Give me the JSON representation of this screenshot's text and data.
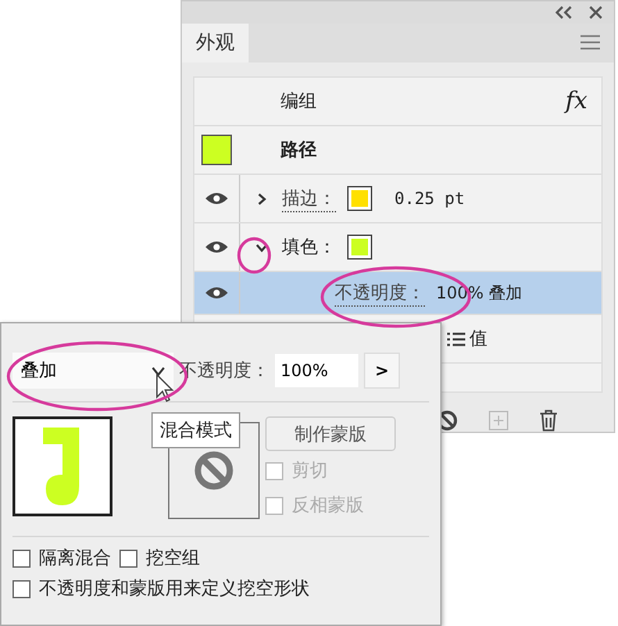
{
  "appearance_panel": {
    "tab": {
      "label": "外观",
      "selected": true
    },
    "rows": [
      {
        "kind": "group",
        "label": "编组",
        "fx": "fx"
      },
      {
        "kind": "path",
        "label": "路径",
        "color": "#ccff22"
      },
      {
        "kind": "stroke",
        "label": "描边：",
        "color": "#ffe000",
        "value": "0.25 pt",
        "expanded": false,
        "visible": true
      },
      {
        "kind": "fill",
        "label": "填色：",
        "color": "#ccff22",
        "expanded": true,
        "visible": true
      },
      {
        "kind": "opacity",
        "label": "不透明度：",
        "value": "100% 叠加",
        "selected": true,
        "visible": true
      },
      {
        "kind": "default",
        "label": "值"
      }
    ]
  },
  "transparency_popup": {
    "blend_mode": "叠加",
    "opacity_label": "不透明度：",
    "opacity_value": "100%",
    "opacity_button": ">",
    "tooltip": "混合模式",
    "make_mask_button": "制作蒙版",
    "mask_options": [
      {
        "label": "剪切",
        "checked": false,
        "disabled": true
      },
      {
        "label": "反相蒙版",
        "checked": false,
        "disabled": true
      }
    ],
    "options": [
      {
        "label": "隔离混合",
        "checked": false
      },
      {
        "label": "挖空组",
        "checked": false
      },
      {
        "label": "不透明度和蒙版用来定义挖空形状",
        "checked": false
      }
    ]
  }
}
